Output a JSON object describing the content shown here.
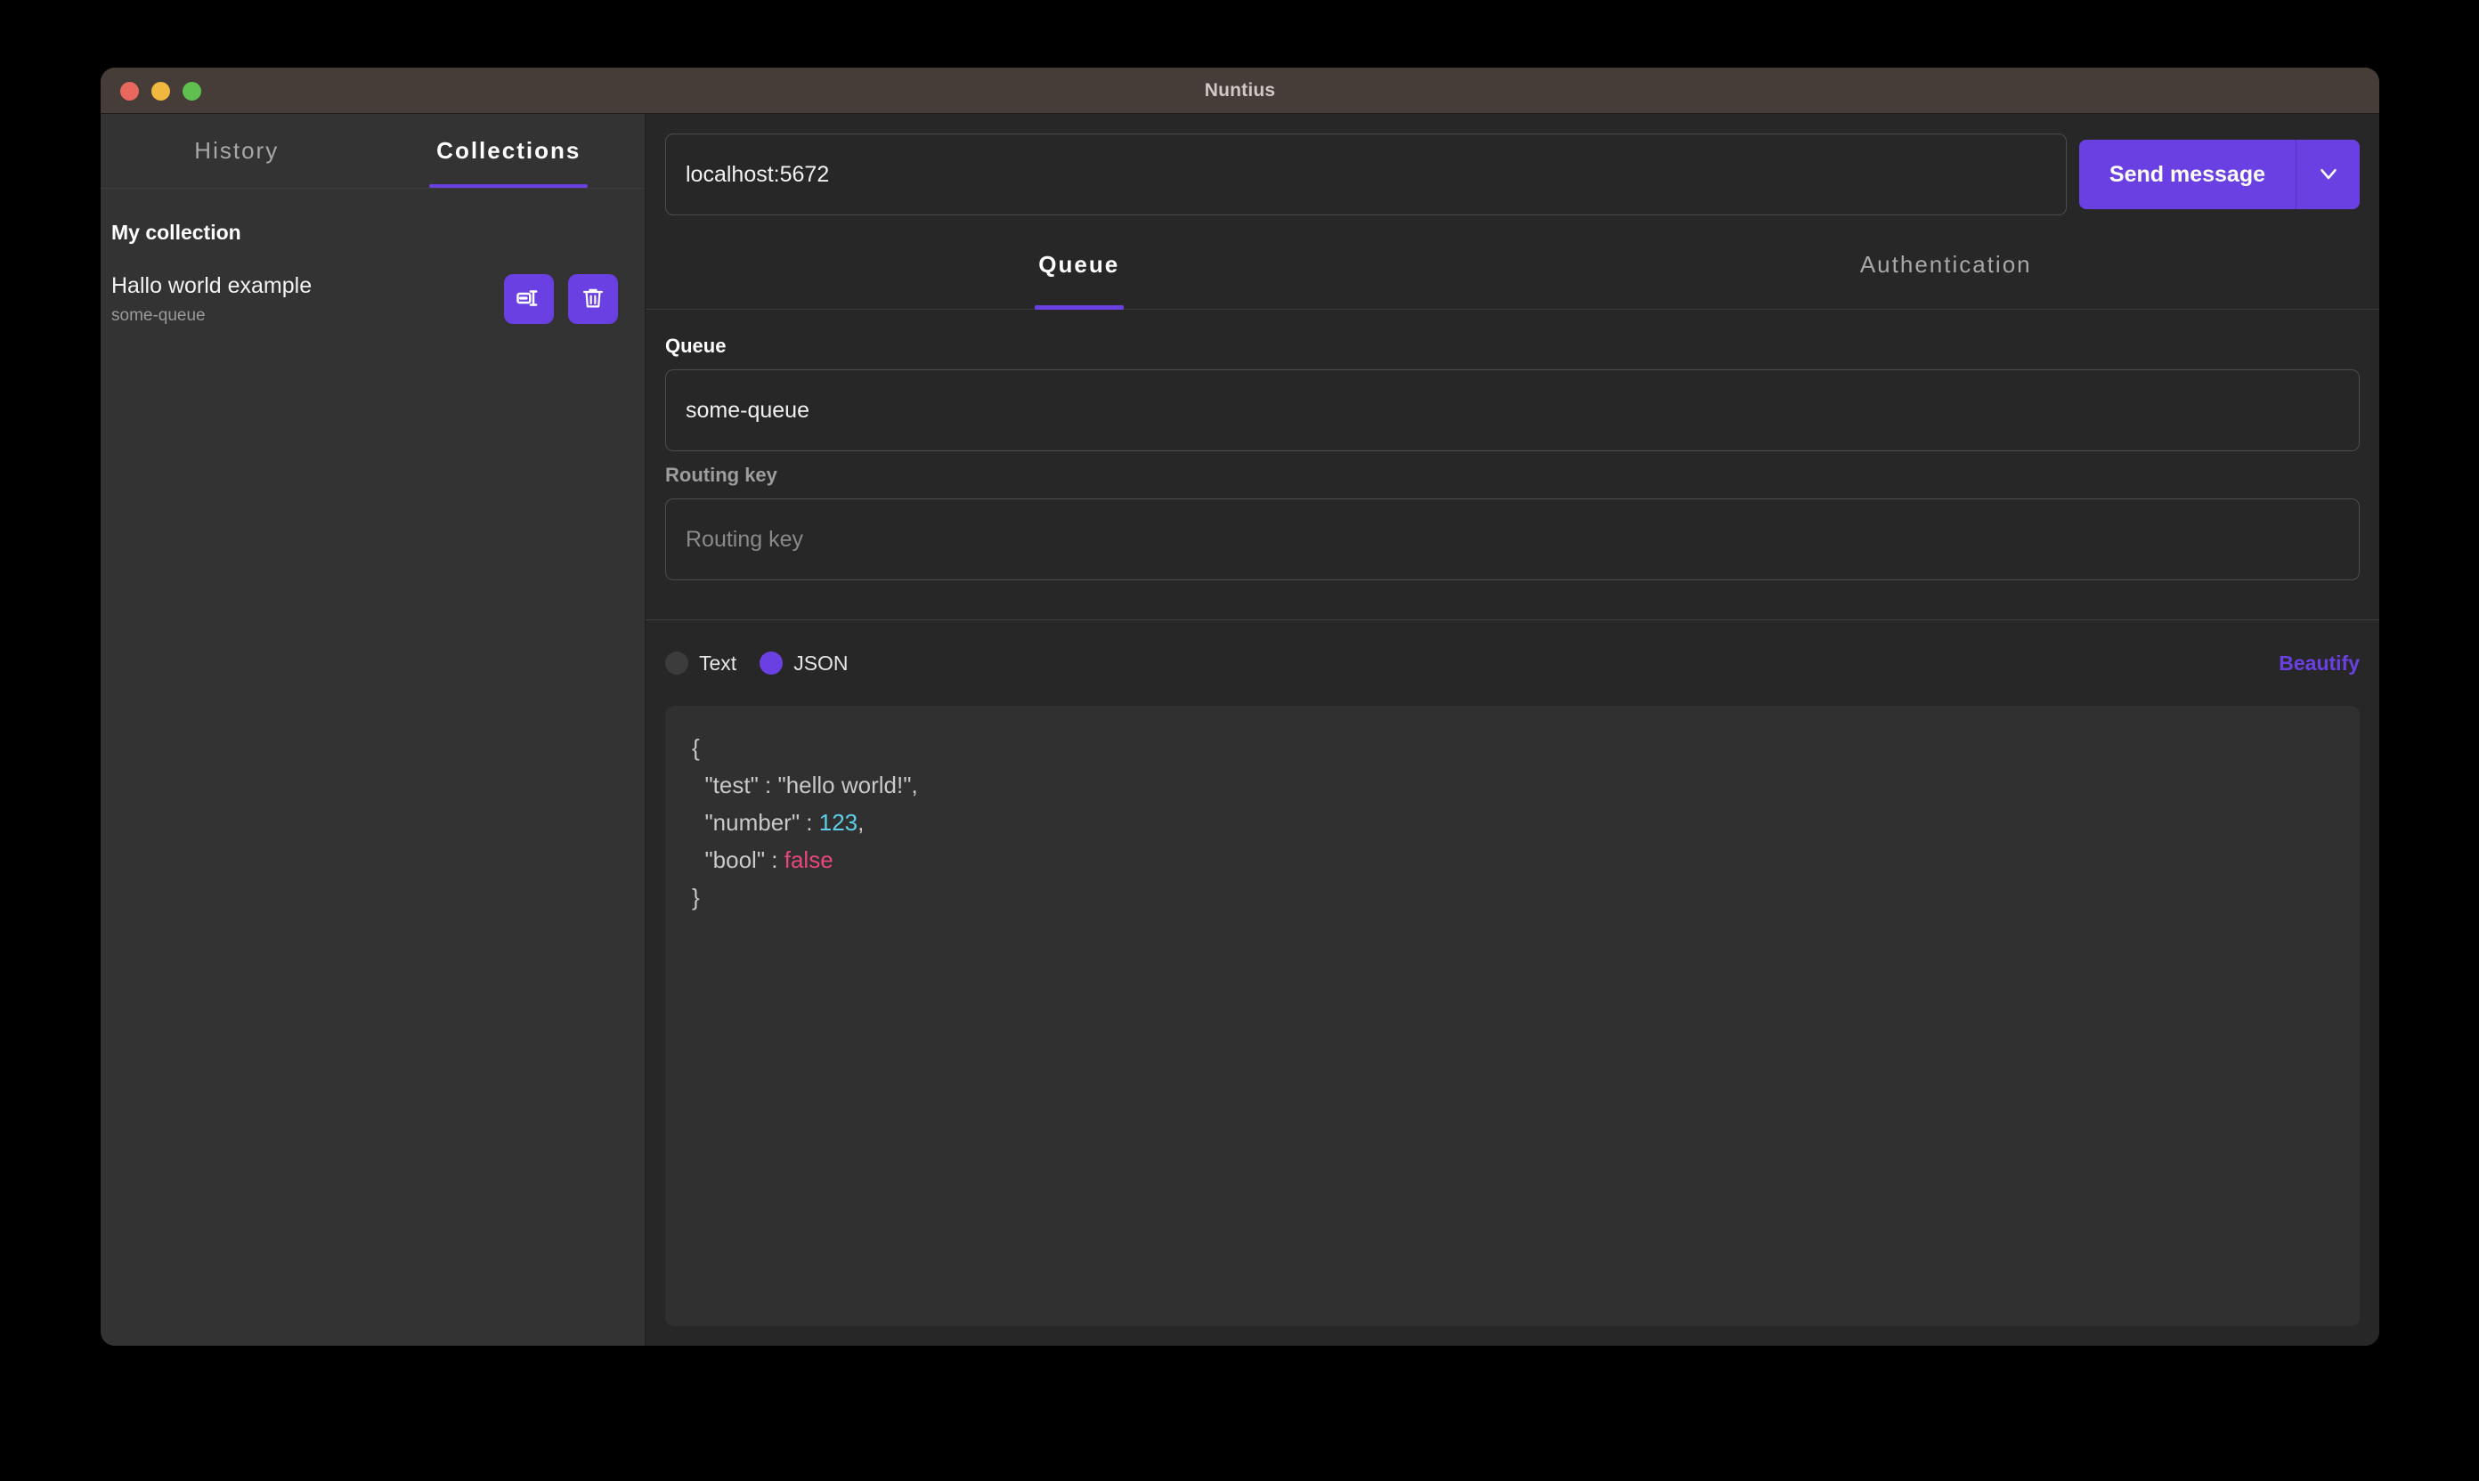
{
  "window": {
    "title": "Nuntius",
    "controls": [
      {
        "name": "close",
        "color": "#e8685e"
      },
      {
        "name": "minimize",
        "color": "#f0b83f"
      },
      {
        "name": "maximize",
        "color": "#5fc04f"
      }
    ]
  },
  "theme": {
    "accent": "#6b40e3",
    "titlebar_bg": "#463d39",
    "sidebar_bg": "#333333",
    "main_bg": "#272727",
    "editor_bg": "#303030",
    "text_primary": "#f1f1f1",
    "text_muted": "#9a9a9a",
    "json_number": "#5ecfe8",
    "json_bool": "#e8467c"
  },
  "sidebar": {
    "tabs": [
      {
        "label": "History",
        "active": false
      },
      {
        "label": "Collections",
        "active": true
      }
    ],
    "collection_title": "My collection",
    "items": [
      {
        "name": "Hallo world example",
        "queue": "some-queue",
        "actions": [
          {
            "icon": "send-message-icon",
            "label": "Send message"
          },
          {
            "icon": "trash-icon",
            "label": "Delete"
          }
        ]
      }
    ]
  },
  "main": {
    "address": {
      "value": "localhost:5672",
      "placeholder": "localhost:5672"
    },
    "send": {
      "label": "Send message",
      "dropdown_icon": "chevron-down-icon"
    },
    "tabs": [
      {
        "label": "Queue",
        "active": true
      },
      {
        "label": "Authentication",
        "active": false
      }
    ],
    "fields": [
      {
        "label": "Queue",
        "value": "some-queue",
        "placeholder": "Queue",
        "muted_label": false
      },
      {
        "label": "Routing key",
        "value": "",
        "placeholder": "Routing key",
        "muted_label": true
      }
    ],
    "body": {
      "format_options": [
        {
          "label": "Text",
          "selected": false
        },
        {
          "label": "JSON",
          "selected": true
        }
      ],
      "beautify_label": "Beautify",
      "content": {
        "open_brace": "{",
        "line_1_key": "  \"test\" : \"hello world!\",",
        "line_2_key": "  \"number\" : ",
        "line_2_value": "123",
        "line_2_comma": ",",
        "line_3_key": "  \"bool\" : ",
        "line_3_value": "false",
        "close_brace": "}"
      }
    }
  }
}
